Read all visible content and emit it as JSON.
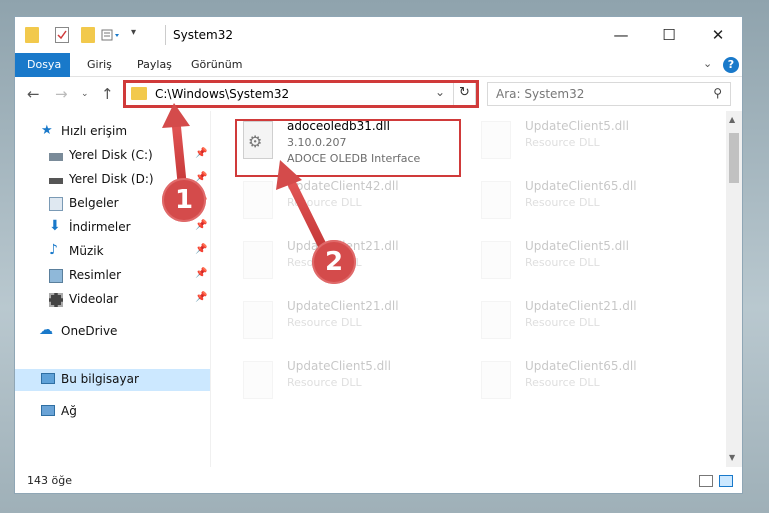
{
  "title": "System32",
  "ribbon": {
    "tabs": [
      "Dosya",
      "Giriş",
      "Paylaş",
      "Görünüm"
    ],
    "active_tab": "Dosya",
    "help": "?"
  },
  "address": {
    "path": "C:\\Windows\\System32",
    "dropdown_glyph": "⌄",
    "refresh_glyph": "↻"
  },
  "search": {
    "placeholder": "Ara: System32"
  },
  "sidebar": {
    "quick_access": "Hızlı erişim",
    "items": [
      {
        "label": "Yerel Disk (C:)",
        "icon": "drive-icon",
        "pinned": true
      },
      {
        "label": "Yerel Disk (D:)",
        "icon": "drive-icon",
        "pinned": true
      },
      {
        "label": "Belgeler",
        "icon": "documents-icon",
        "pinned": true
      },
      {
        "label": "İndirmeler",
        "icon": "download-icon",
        "pinned": true
      },
      {
        "label": "Müzik",
        "icon": "music-icon",
        "pinned": true
      },
      {
        "label": "Resimler",
        "icon": "pictures-icon",
        "pinned": true
      },
      {
        "label": "Videolar",
        "icon": "video-icon",
        "pinned": true
      }
    ],
    "onedrive": "OneDrive",
    "this_pc": "Bu bilgisayar",
    "network": "Ağ"
  },
  "files": {
    "highlighted": {
      "name": "adoceoledb31.dll",
      "version": "3.10.0.207",
      "description": "ADOCE OLEDB Interface"
    },
    "left_column": [
      {
        "name": "UpdateClient42.dll",
        "description": "Resource DLL"
      },
      {
        "name": "UpdateClient21.dll",
        "description": "Resource DLL"
      },
      {
        "name": "UpdateClient21.dll",
        "description": "Resource DLL"
      },
      {
        "name": "UpdateClient5.dll",
        "description": "Resource DLL"
      }
    ],
    "right_column": [
      {
        "name": "UpdateClient5.dll",
        "description": "Resource DLL"
      },
      {
        "name": "UpdateClient65.dll",
        "description": "Resource DLL"
      },
      {
        "name": "UpdateClient5.dll",
        "description": "Resource DLL"
      },
      {
        "name": "UpdateClient21.dll",
        "description": "Resource DLL"
      },
      {
        "name": "UpdateClient65.dll",
        "description": "Resource DLL"
      }
    ]
  },
  "status": {
    "count": "143 öğe"
  },
  "annotations": {
    "step1": "1",
    "step2": "2"
  },
  "colors": {
    "accent": "#1979ca",
    "annotation": "#d03a3a",
    "selection": "#cce8ff"
  }
}
